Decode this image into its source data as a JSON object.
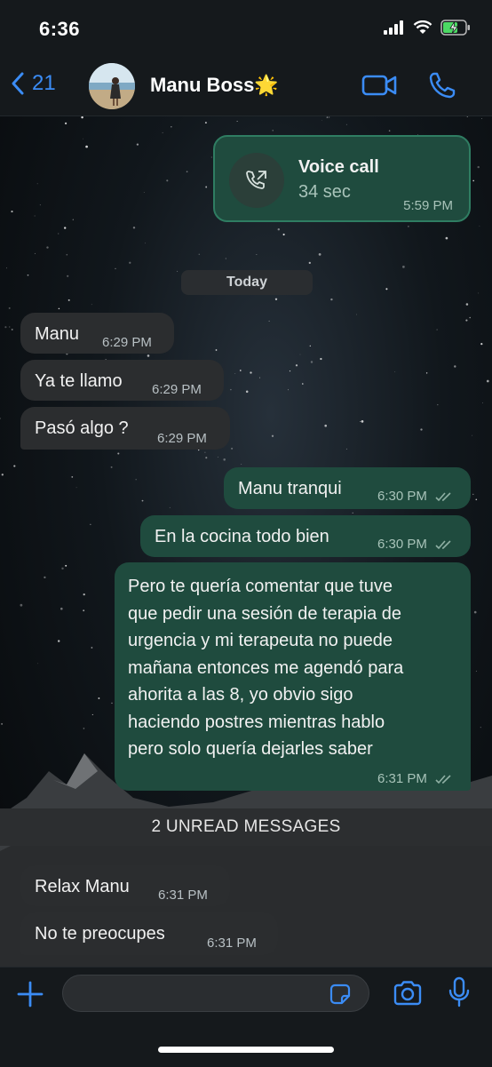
{
  "status_bar": {
    "time": "6:36"
  },
  "header": {
    "back_count": "21",
    "contact_name": "Manu Boss🌟"
  },
  "call_card": {
    "title": "Voice call",
    "duration": "34 sec",
    "time": "5:59 PM"
  },
  "date_separator": "Today",
  "messages": [
    {
      "direction": "in",
      "text": "Manu",
      "time": "6:29 PM"
    },
    {
      "direction": "in",
      "text": "Ya te llamo",
      "time": "6:29 PM"
    },
    {
      "direction": "in",
      "text": "Pasó algo ?",
      "time": "6:29 PM"
    },
    {
      "direction": "out",
      "text": "Manu tranqui",
      "time": "6:30 PM"
    },
    {
      "direction": "out",
      "text": "En la cocina todo bien",
      "time": "6:30 PM"
    },
    {
      "direction": "out",
      "lines": [
        "Pero te quería comentar que tuve",
        "que pedir una sesión de terapia de",
        "urgencia y mi terapeuta no puede",
        "mañana entonces me agendó para",
        "ahorita a las 8, yo obvio sigo",
        "haciendo postres mientras hablo",
        "pero solo quería dejarles saber"
      ],
      "time": "6:31 PM"
    },
    {
      "direction": "in",
      "text": "Relax Manu",
      "time": "6:31 PM"
    },
    {
      "direction": "in",
      "text": "No te preocupes",
      "time": "6:31 PM"
    }
  ],
  "unread_banner": "2 UNREAD MESSAGES",
  "composer": {
    "placeholder": ""
  },
  "colors": {
    "accent": "#3b8cf5",
    "outgoing_bubble": "#1f4b3e",
    "incoming_bubble": "#2b2d2f",
    "bar_background": "#15191c"
  }
}
